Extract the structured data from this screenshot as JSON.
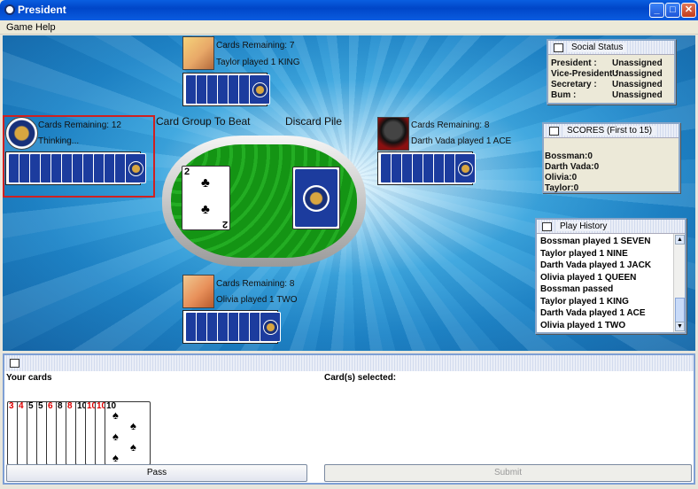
{
  "window": {
    "title": "President",
    "minimize": "_",
    "maximize": "□",
    "close": "✕"
  },
  "menu": [
    "Game",
    "Help"
  ],
  "table": {
    "group_label": "Card Group To Beat",
    "discard_label": "Discard Pile",
    "current_card": {
      "rank": "2",
      "suit": "♣"
    }
  },
  "players": {
    "top": {
      "remaining": "Cards Remaining: 7",
      "status": "Taylor played 1 KING",
      "count": 7
    },
    "left": {
      "remaining": "Cards Remaining: 12",
      "status": "Thinking...",
      "count": 12
    },
    "right": {
      "remaining": "Cards Remaining: 8",
      "status": "Darth Vada played 1 ACE",
      "count": 8
    },
    "bottom": {
      "remaining": "Cards Remaining: 8",
      "status": "Olivia played 1 TWO",
      "count": 8
    }
  },
  "social": {
    "title": "Social Status",
    "rows": [
      {
        "label": "President :",
        "value": "Unassigned"
      },
      {
        "label": "Vice-President :",
        "value": "Unassigned"
      },
      {
        "label": "Secretary :",
        "value": "Unassigned"
      },
      {
        "label": "Bum :",
        "value": "Unassigned"
      }
    ]
  },
  "scores": {
    "title": "SCORES (First to 15)",
    "rows": [
      "Bossman:0",
      "Darth Vada:0",
      "Olivia:0",
      "Taylor:0"
    ]
  },
  "history": {
    "title": "Play History",
    "rows": [
      "Bossman played 1 SEVEN",
      "Taylor played 1 NINE",
      "Darth Vada played 1 JACK",
      "Olivia played 1 QUEEN",
      "Bossman passed",
      "Taylor played 1 KING",
      "Darth Vada played 1 ACE",
      "Olivia played 1 TWO"
    ]
  },
  "hand": {
    "your_cards": "Your cards",
    "selected": "Card(s) selected:",
    "cards": [
      {
        "rank": "3",
        "color": "#d00"
      },
      {
        "rank": "4",
        "color": "#d00"
      },
      {
        "rank": "5",
        "color": "#000"
      },
      {
        "rank": "5",
        "color": "#000"
      },
      {
        "rank": "6",
        "color": "#d00"
      },
      {
        "rank": "8",
        "color": "#000"
      },
      {
        "rank": "8",
        "color": "#d00"
      },
      {
        "rank": "10",
        "color": "#000"
      },
      {
        "rank": "10",
        "color": "#d00"
      },
      {
        "rank": "10",
        "color": "#d00"
      },
      {
        "rank": "10",
        "color": "#000"
      }
    ],
    "pass": "Pass",
    "submit": "Submit"
  }
}
